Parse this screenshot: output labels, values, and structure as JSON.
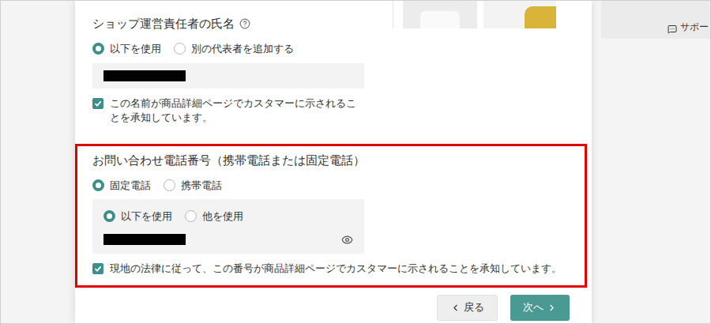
{
  "shop_manager": {
    "label": "ショップ運営責任者の氏名",
    "options": [
      {
        "label": "以下を使用",
        "selected": true
      },
      {
        "label": "別の代表者を追加する",
        "selected": false
      }
    ],
    "acknowledge": {
      "label": "この名前が商品詳細ページでカスタマーに示されることを承知しています。",
      "checked": true
    }
  },
  "contact_phone": {
    "label": "お問い合わせ電話番号（携帯電話または固定電話）",
    "types": [
      {
        "label": "固定電話",
        "selected": true
      },
      {
        "label": "携帯電話",
        "selected": false
      }
    ],
    "sources": [
      {
        "label": "以下を使用",
        "selected": true
      },
      {
        "label": "他を使用",
        "selected": false
      }
    ],
    "acknowledge": {
      "label": "現地の法律に従って、この番号が商品詳細ページでカスタマーに示されることを承知しています。",
      "checked": true
    }
  },
  "buttons": [
    {
      "label": "戻る",
      "kind": "back"
    },
    {
      "label": "次へ",
      "kind": "next"
    }
  ],
  "support": {
    "label": "サポー"
  }
}
